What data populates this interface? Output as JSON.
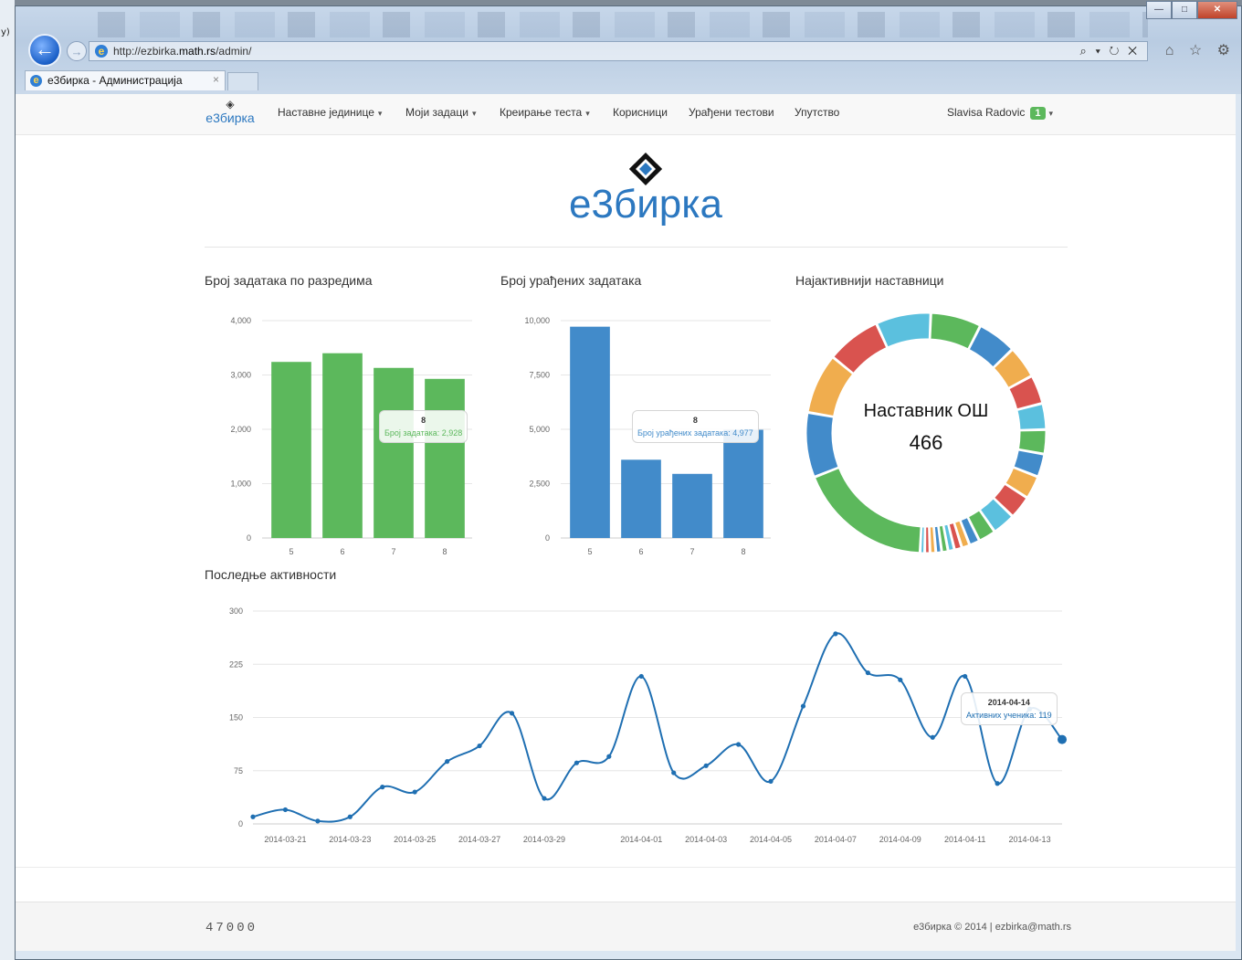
{
  "browser": {
    "url_prefix": "http://ezbirka.",
    "url_domain": "math.rs",
    "url_path": "/admin/",
    "tab_title": "е3бирка - Администрација",
    "tab_close": "×",
    "back_glyph": "←",
    "forward_glyph": "→",
    "addr_tools": "⌕ ▾ ↻ ✕",
    "fav_icons": "⌂ ☆ ⚙",
    "win_min": "—",
    "win_max": "□",
    "win_close": "✕"
  },
  "nav": {
    "brand": "е3бирка",
    "items": [
      {
        "label": "Наставне јединице",
        "dropdown": true
      },
      {
        "label": "Моји задаци",
        "dropdown": true
      },
      {
        "label": "Креирање теста",
        "dropdown": true
      },
      {
        "label": "Корисници",
        "dropdown": false
      },
      {
        "label": "Урађени тестови",
        "dropdown": false
      },
      {
        "label": "Упутство",
        "dropdown": false
      }
    ],
    "user": "Slavisa Radovic",
    "user_badge": "1",
    "caret": "▾"
  },
  "logo": {
    "name": "е3бирка"
  },
  "chart_titles": {
    "tasks_by_grade": "Број задатака по разредима",
    "completed_tasks": "Број урађених задатака",
    "top_teachers": "Најактивнији наставници",
    "recent_activity": "Последње активности"
  },
  "chart_data": [
    {
      "type": "bar",
      "title": "Број задатака по разредима",
      "categories": [
        "5",
        "6",
        "7",
        "8"
      ],
      "values": [
        3240,
        3400,
        3130,
        2928
      ],
      "ylim": [
        0,
        4000
      ],
      "yticks": [
        "0",
        "1,000",
        "2,000",
        "3,000",
        "4,000"
      ],
      "color": "#5cb85c",
      "tooltip": {
        "category": "8",
        "label": "Број задатака: 2,928"
      }
    },
    {
      "type": "bar",
      "title": "Број урађених задатака",
      "categories": [
        "5",
        "6",
        "7",
        "8"
      ],
      "values": [
        9720,
        3600,
        2950,
        4977
      ],
      "ylim": [
        0,
        10000
      ],
      "yticks": [
        "0",
        "2,500",
        "5,000",
        "7,500",
        "10,000"
      ],
      "color": "#428bca",
      "tooltip": {
        "category": "8",
        "label": "Број урађених задатака: 4,977"
      }
    },
    {
      "type": "pie",
      "title": "Најактивнији наставници",
      "center_label": "Наставник ОШ",
      "center_value": "466",
      "colors": [
        "#5cb85c",
        "#428bca",
        "#f0ad4e",
        "#d9534f",
        "#5bc0de",
        "#5cb85c",
        "#428bca",
        "#f0ad4e",
        "#d9534f",
        "#5bc0de",
        "#5cb85c",
        "#428bca",
        "#f0ad4e",
        "#d9534f",
        "#5bc0de",
        "#5cb85c",
        "#428bca",
        "#f0ad4e",
        "#d9534f",
        "#5bc0de",
        "#5cb85c",
        "#428bca",
        "#f0ad4e",
        "#d9534f",
        "#5bc0de"
      ],
      "values": [
        466,
        224,
        208,
        188,
        190,
        175,
        135,
        112,
        100,
        90,
        84,
        80,
        80,
        80,
        80,
        60,
        36,
        28,
        26,
        22,
        22,
        20,
        20,
        18,
        16
      ]
    },
    {
      "type": "line",
      "title": "Последње активности",
      "x": [
        "2014-03-20",
        "2014-03-21",
        "2014-03-22",
        "2014-03-23",
        "2014-03-24",
        "2014-03-25",
        "2014-03-26",
        "2014-03-27",
        "2014-03-28",
        "2014-03-29",
        "2014-03-30",
        "2014-03-31",
        "2014-04-01",
        "2014-04-02",
        "2014-04-03",
        "2014-04-04",
        "2014-04-05",
        "2014-04-06",
        "2014-04-07",
        "2014-04-08",
        "2014-04-09",
        "2014-04-10",
        "2014-04-11",
        "2014-04-12",
        "2014-04-13",
        "2014-04-14"
      ],
      "values": [
        10,
        20,
        4,
        10,
        52,
        45,
        88,
        110,
        156,
        36,
        86,
        95,
        208,
        72,
        82,
        112,
        60,
        166,
        268,
        213,
        203,
        122,
        208,
        57,
        162,
        119
      ],
      "xtick_labels": [
        "2014-03-21",
        "2014-03-23",
        "2014-03-25",
        "2014-03-27",
        "2014-03-29",
        "2014-04-01",
        "2014-04-03",
        "2014-04-05",
        "2014-04-07",
        "2014-04-09",
        "2014-04-11",
        "2014-04-13"
      ],
      "ylim": [
        0,
        300
      ],
      "yticks": [
        "0",
        "75",
        "150",
        "225",
        "300"
      ],
      "color": "#1f6fb2",
      "tooltip": {
        "date": "2014-04-14",
        "label": "Активних ученика: 119"
      }
    }
  ],
  "footer": {
    "counter": "47000",
    "copyright": "е3бирка © 2014 | ezbirka@math.rs"
  }
}
